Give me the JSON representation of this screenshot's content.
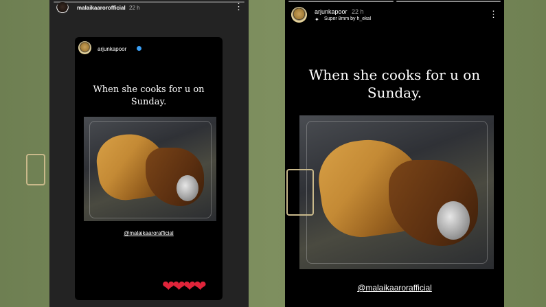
{
  "left_story": {
    "username": "malaikaarorofficial",
    "time": "22 h",
    "menu_icon": "more-vertical-icon",
    "shared_post": {
      "username": "arjunkapoor",
      "verified_icon": "verified-badge-icon",
      "caption": "When she cooks for u on Sunday.",
      "mention": "@malaikaarorafficial"
    },
    "hearts": "❤❤❤❤"
  },
  "right_story": {
    "username": "arjunkapoor",
    "time": "22 h",
    "music_icon": "music-sparkle-icon",
    "music": "Super 8mm by h_ekal",
    "menu_icon": "more-vertical-icon",
    "caption": "When she cooks for u on Sunday.",
    "mention": "@malaikaarorafficial"
  },
  "colors": {
    "background": "#7a8a5b",
    "heart": "#e0243a",
    "verified": "#3a9ff5"
  }
}
